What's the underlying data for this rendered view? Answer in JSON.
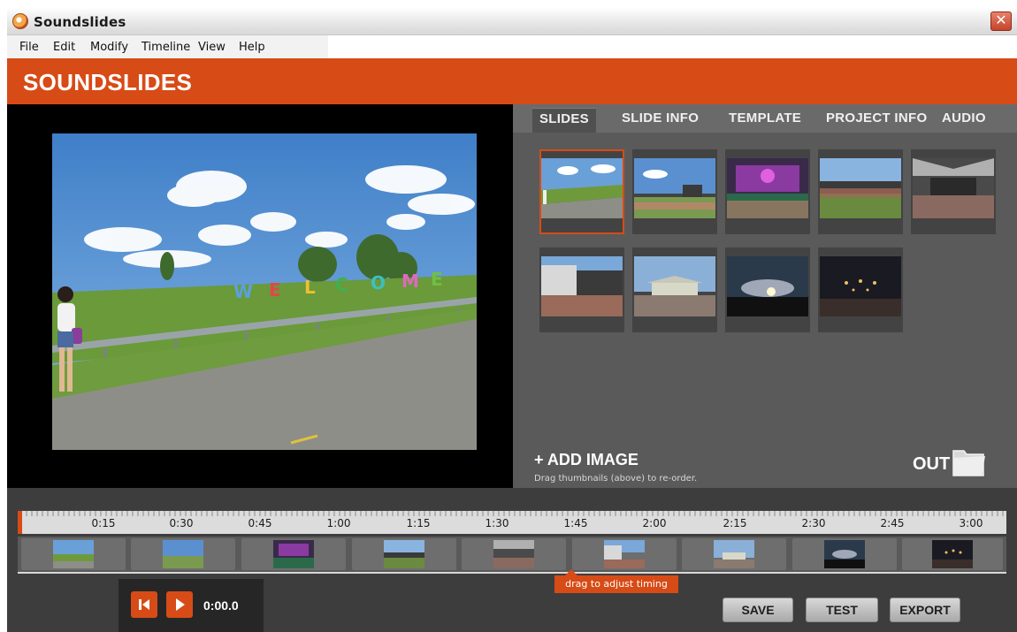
{
  "window": {
    "title": "Soundslides",
    "close_icon": "close-icon"
  },
  "menu": [
    "File",
    "Edit",
    "Modify",
    "Timeline",
    "View",
    "Help"
  ],
  "brand": {
    "title": "SOUNDSLIDES",
    "accent": "#d74b16"
  },
  "tabs": [
    {
      "label": "SLIDES",
      "active": true
    },
    {
      "label": "SLIDE INFO",
      "active": false
    },
    {
      "label": "TEMPLATE",
      "active": false
    },
    {
      "label": "PROJECT INFO",
      "active": false
    },
    {
      "label": "AUDIO",
      "active": false
    }
  ],
  "slides": [
    {
      "scene": "road-welcome",
      "selected": true
    },
    {
      "scene": "field-stage"
    },
    {
      "scene": "purple-stage"
    },
    {
      "scene": "crowd-day"
    },
    {
      "scene": "tent-crowd"
    },
    {
      "scene": "stage-side"
    },
    {
      "scene": "pavilion"
    },
    {
      "scene": "sunset"
    },
    {
      "scene": "night-stage"
    }
  ],
  "panel": {
    "add_image": "+ ADD IMAGE",
    "add_hint": "Drag thumbnails (above) to re-order.",
    "out_label": "OUT",
    "out_icon": "folder-icon"
  },
  "timeline": {
    "ticks": [
      "0:15",
      "0:30",
      "0:45",
      "1:00",
      "1:15",
      "1:30",
      "1:45",
      "2:00",
      "2:15",
      "2:30",
      "2:45",
      "3:00"
    ],
    "drag_hint": "drag to adjust timing",
    "time": "0:00.0",
    "rewind_icon": "skip-back-icon",
    "play_icon": "play-icon"
  },
  "actions": {
    "save": "SAVE",
    "test": "TEST",
    "export": "EXPORT"
  }
}
